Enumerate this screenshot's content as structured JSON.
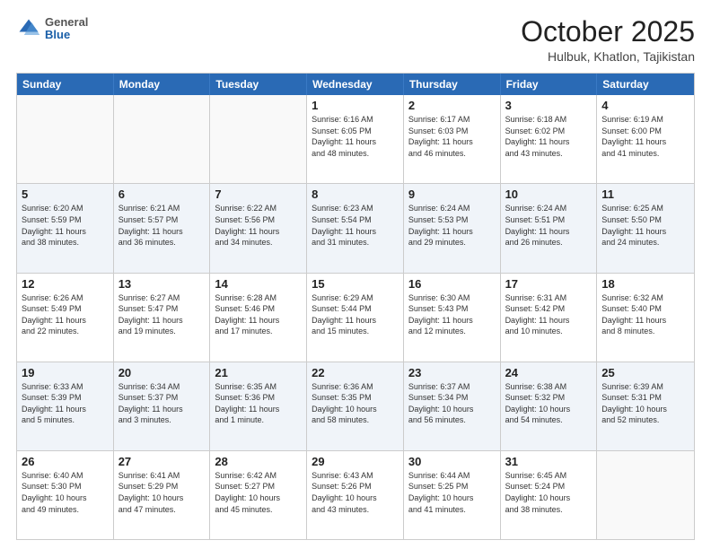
{
  "header": {
    "logo": {
      "general": "General",
      "blue": "Blue"
    },
    "title": "October 2025",
    "location": "Hulbuk, Khatlon, Tajikistan"
  },
  "calendar": {
    "days": [
      "Sunday",
      "Monday",
      "Tuesday",
      "Wednesday",
      "Thursday",
      "Friday",
      "Saturday"
    ],
    "rows": [
      [
        {
          "day": "",
          "text": ""
        },
        {
          "day": "",
          "text": ""
        },
        {
          "day": "",
          "text": ""
        },
        {
          "day": "1",
          "text": "Sunrise: 6:16 AM\nSunset: 6:05 PM\nDaylight: 11 hours\nand 48 minutes."
        },
        {
          "day": "2",
          "text": "Sunrise: 6:17 AM\nSunset: 6:03 PM\nDaylight: 11 hours\nand 46 minutes."
        },
        {
          "day": "3",
          "text": "Sunrise: 6:18 AM\nSunset: 6:02 PM\nDaylight: 11 hours\nand 43 minutes."
        },
        {
          "day": "4",
          "text": "Sunrise: 6:19 AM\nSunset: 6:00 PM\nDaylight: 11 hours\nand 41 minutes."
        }
      ],
      [
        {
          "day": "5",
          "text": "Sunrise: 6:20 AM\nSunset: 5:59 PM\nDaylight: 11 hours\nand 38 minutes."
        },
        {
          "day": "6",
          "text": "Sunrise: 6:21 AM\nSunset: 5:57 PM\nDaylight: 11 hours\nand 36 minutes."
        },
        {
          "day": "7",
          "text": "Sunrise: 6:22 AM\nSunset: 5:56 PM\nDaylight: 11 hours\nand 34 minutes."
        },
        {
          "day": "8",
          "text": "Sunrise: 6:23 AM\nSunset: 5:54 PM\nDaylight: 11 hours\nand 31 minutes."
        },
        {
          "day": "9",
          "text": "Sunrise: 6:24 AM\nSunset: 5:53 PM\nDaylight: 11 hours\nand 29 minutes."
        },
        {
          "day": "10",
          "text": "Sunrise: 6:24 AM\nSunset: 5:51 PM\nDaylight: 11 hours\nand 26 minutes."
        },
        {
          "day": "11",
          "text": "Sunrise: 6:25 AM\nSunset: 5:50 PM\nDaylight: 11 hours\nand 24 minutes."
        }
      ],
      [
        {
          "day": "12",
          "text": "Sunrise: 6:26 AM\nSunset: 5:49 PM\nDaylight: 11 hours\nand 22 minutes."
        },
        {
          "day": "13",
          "text": "Sunrise: 6:27 AM\nSunset: 5:47 PM\nDaylight: 11 hours\nand 19 minutes."
        },
        {
          "day": "14",
          "text": "Sunrise: 6:28 AM\nSunset: 5:46 PM\nDaylight: 11 hours\nand 17 minutes."
        },
        {
          "day": "15",
          "text": "Sunrise: 6:29 AM\nSunset: 5:44 PM\nDaylight: 11 hours\nand 15 minutes."
        },
        {
          "day": "16",
          "text": "Sunrise: 6:30 AM\nSunset: 5:43 PM\nDaylight: 11 hours\nand 12 minutes."
        },
        {
          "day": "17",
          "text": "Sunrise: 6:31 AM\nSunset: 5:42 PM\nDaylight: 11 hours\nand 10 minutes."
        },
        {
          "day": "18",
          "text": "Sunrise: 6:32 AM\nSunset: 5:40 PM\nDaylight: 11 hours\nand 8 minutes."
        }
      ],
      [
        {
          "day": "19",
          "text": "Sunrise: 6:33 AM\nSunset: 5:39 PM\nDaylight: 11 hours\nand 5 minutes."
        },
        {
          "day": "20",
          "text": "Sunrise: 6:34 AM\nSunset: 5:37 PM\nDaylight: 11 hours\nand 3 minutes."
        },
        {
          "day": "21",
          "text": "Sunrise: 6:35 AM\nSunset: 5:36 PM\nDaylight: 11 hours\nand 1 minute."
        },
        {
          "day": "22",
          "text": "Sunrise: 6:36 AM\nSunset: 5:35 PM\nDaylight: 10 hours\nand 58 minutes."
        },
        {
          "day": "23",
          "text": "Sunrise: 6:37 AM\nSunset: 5:34 PM\nDaylight: 10 hours\nand 56 minutes."
        },
        {
          "day": "24",
          "text": "Sunrise: 6:38 AM\nSunset: 5:32 PM\nDaylight: 10 hours\nand 54 minutes."
        },
        {
          "day": "25",
          "text": "Sunrise: 6:39 AM\nSunset: 5:31 PM\nDaylight: 10 hours\nand 52 minutes."
        }
      ],
      [
        {
          "day": "26",
          "text": "Sunrise: 6:40 AM\nSunset: 5:30 PM\nDaylight: 10 hours\nand 49 minutes."
        },
        {
          "day": "27",
          "text": "Sunrise: 6:41 AM\nSunset: 5:29 PM\nDaylight: 10 hours\nand 47 minutes."
        },
        {
          "day": "28",
          "text": "Sunrise: 6:42 AM\nSunset: 5:27 PM\nDaylight: 10 hours\nand 45 minutes."
        },
        {
          "day": "29",
          "text": "Sunrise: 6:43 AM\nSunset: 5:26 PM\nDaylight: 10 hours\nand 43 minutes."
        },
        {
          "day": "30",
          "text": "Sunrise: 6:44 AM\nSunset: 5:25 PM\nDaylight: 10 hours\nand 41 minutes."
        },
        {
          "day": "31",
          "text": "Sunrise: 6:45 AM\nSunset: 5:24 PM\nDaylight: 10 hours\nand 38 minutes."
        },
        {
          "day": "",
          "text": ""
        }
      ]
    ]
  }
}
